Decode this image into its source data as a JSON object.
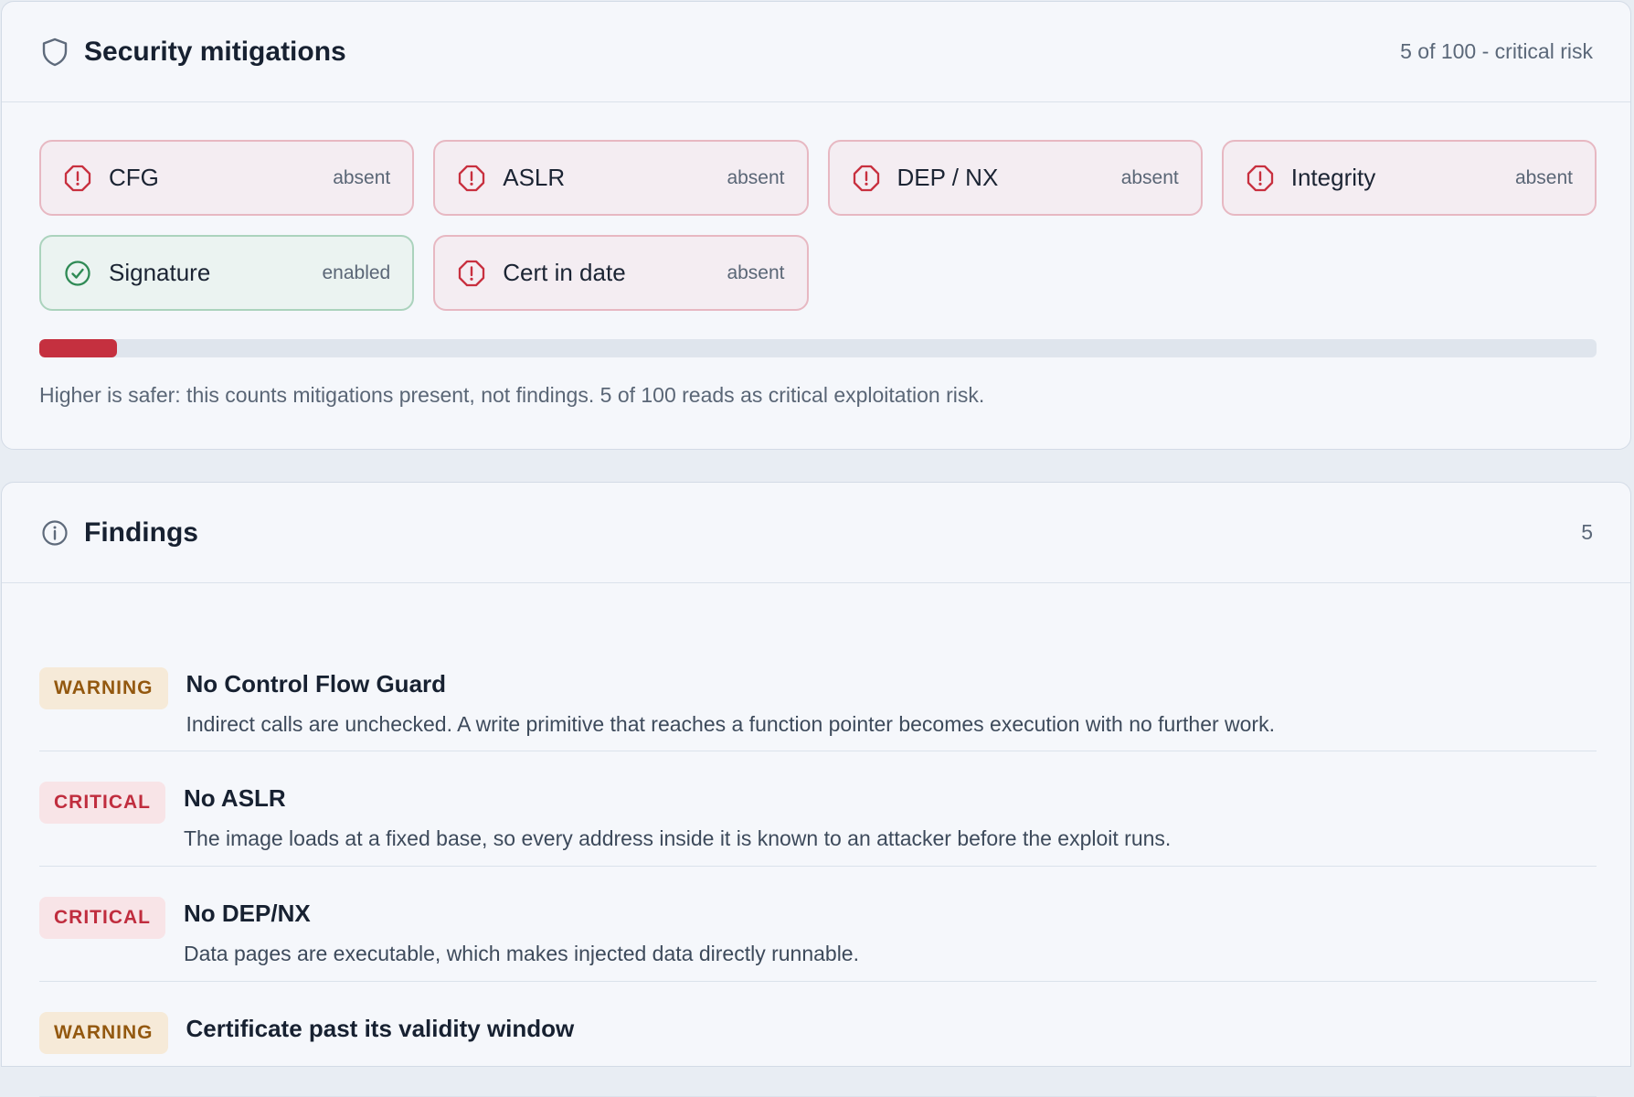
{
  "mitigations_panel": {
    "title": "Security mitigations",
    "score_text": "5 of 100 - critical risk",
    "score_percent": 5,
    "note": "Higher is safer: this counts mitigations present, not findings. 5 of 100 reads as critical exploitation risk.",
    "icon": "shield-icon",
    "items": [
      {
        "name": "CFG",
        "state": "absent",
        "status": "bad",
        "icon": "alert-octagon-icon"
      },
      {
        "name": "ASLR",
        "state": "absent",
        "status": "bad",
        "icon": "alert-octagon-icon"
      },
      {
        "name": "DEP / NX",
        "state": "absent",
        "status": "bad",
        "icon": "alert-octagon-icon"
      },
      {
        "name": "Integrity",
        "state": "absent",
        "status": "bad",
        "icon": "alert-octagon-icon"
      },
      {
        "name": "Signature",
        "state": "enabled",
        "status": "ok",
        "icon": "check-circle-icon"
      },
      {
        "name": "Cert in date",
        "state": "absent",
        "status": "bad",
        "icon": "alert-octagon-icon"
      }
    ]
  },
  "findings_panel": {
    "title": "Findings",
    "count": "5",
    "icon": "info-icon",
    "items": [
      {
        "severity": "WARNING",
        "title": "No Control Flow Guard",
        "description": "Indirect calls are unchecked. A write primitive that reaches a function pointer becomes execution with no further work."
      },
      {
        "severity": "CRITICAL",
        "title": "No ASLR",
        "description": "The image loads at a fixed base, so every address inside it is known to an attacker before the exploit runs."
      },
      {
        "severity": "CRITICAL",
        "title": "No DEP/NX",
        "description": "Data pages are executable, which makes injected data directly runnable."
      },
      {
        "severity": "WARNING",
        "title": "Certificate past its validity window",
        "description": ""
      }
    ]
  },
  "colors": {
    "critical": "#c5303f",
    "warning": "#93580f",
    "ok": "#2f8a55",
    "bad_icon": "#c8303f"
  }
}
